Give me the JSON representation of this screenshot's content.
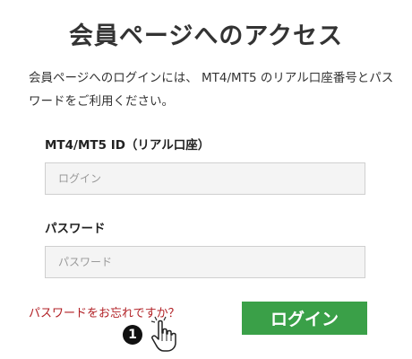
{
  "page": {
    "title": "会員ページへのアクセス",
    "intro": "会員ページへのログインには、 MT4/MT5 のリアル口座番号とパスワードをご利用ください。"
  },
  "form": {
    "id_label": "MT4/MT5 ID（リアル口座）",
    "id_placeholder": "ログイン",
    "password_label": "パスワード",
    "password_placeholder": "パスワード",
    "forgot_link": "パスワードをお忘れですか？",
    "login_button": "ログイン"
  },
  "annotation": {
    "step_number": "❶"
  },
  "colors": {
    "accent_green": "#3aa048",
    "link_red": "#b11f24",
    "input_bg": "#f4f4f4"
  }
}
